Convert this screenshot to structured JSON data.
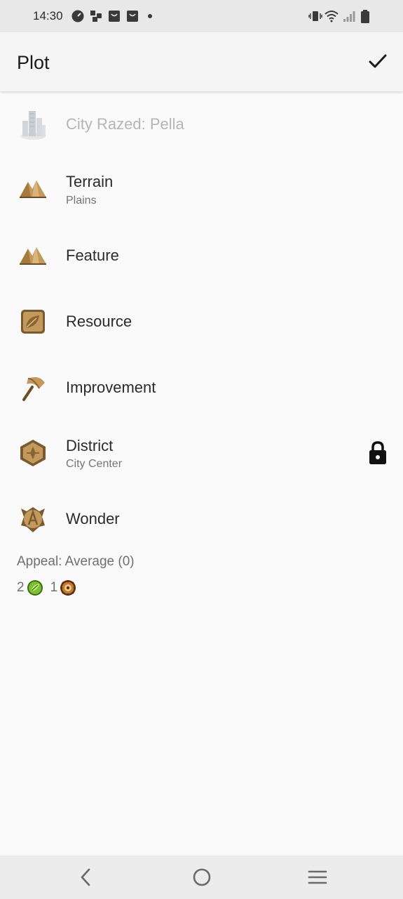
{
  "status_bar": {
    "time": "14:30",
    "left_icons": [
      "speedometer-icon",
      "app-icon",
      "shopping-bag-icon",
      "shopping-bag-icon",
      "dot-icon"
    ],
    "right_icons": [
      "vibrate-icon",
      "wifi-icon",
      "signal-icon",
      "battery-icon"
    ]
  },
  "app_bar": {
    "title": "Plot",
    "confirm_icon": "checkmark-icon"
  },
  "items": [
    {
      "title": "City Razed: Pella",
      "subtitle": "",
      "icon": "city-icon",
      "enabled": false,
      "locked": false
    },
    {
      "title": "Terrain",
      "subtitle": "Plains",
      "icon": "mountain-icon",
      "enabled": true,
      "locked": false
    },
    {
      "title": "Feature",
      "subtitle": "",
      "icon": "mountain-icon",
      "enabled": true,
      "locked": false
    },
    {
      "title": "Resource",
      "subtitle": "",
      "icon": "resource-icon",
      "enabled": true,
      "locked": false
    },
    {
      "title": "Improvement",
      "subtitle": "",
      "icon": "hammer-icon",
      "enabled": true,
      "locked": false
    },
    {
      "title": "District",
      "subtitle": "City Center",
      "icon": "district-icon",
      "enabled": true,
      "locked": true
    },
    {
      "title": "Wonder",
      "subtitle": "",
      "icon": "wonder-icon",
      "enabled": true,
      "locked": false
    }
  ],
  "appeal": "Appeal: Average (0)",
  "yields": [
    {
      "value": "2",
      "icon": "food-icon",
      "color": "#5a9e1e"
    },
    {
      "value": "1",
      "icon": "production-icon",
      "color": "#8a4a1a"
    }
  ],
  "colors": {
    "icon_gold": "#c39a5b",
    "icon_dark": "#7a5a2e",
    "disabled": "#b5b5b5"
  },
  "nav_bar": {
    "icons": [
      "back-icon",
      "home-icon",
      "menu-icon"
    ]
  }
}
